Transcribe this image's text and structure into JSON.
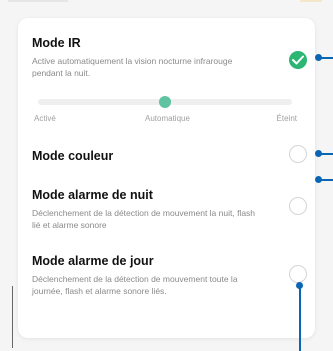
{
  "settings": {
    "ir": {
      "title": "Mode IR",
      "description": "Active automatiquement la vision nocturne infrarouge pendant la nuit.",
      "enabled": true,
      "slider": {
        "options": [
          "Activé",
          "Automatique",
          "Éteint"
        ],
        "selected": "Automatique",
        "selected_fraction": 0.5
      }
    },
    "color": {
      "title": "Mode couleur",
      "enabled": false
    },
    "night_alarm": {
      "title": "Mode alarme de nuit",
      "description": "Déclenchement de la détection de mouvement la nuit, flash lié et alarme sonore",
      "enabled": false
    },
    "day_alarm": {
      "title": "Mode alarme de jour",
      "description": "Déclenchement de la détection de mouvement toute la journée, flash et alarme sonore liés.",
      "enabled": false
    }
  },
  "colors": {
    "accent_green": "#2bb673",
    "slider_thumb": "#5fc3a2",
    "callout_blue": "#0a66b5"
  }
}
